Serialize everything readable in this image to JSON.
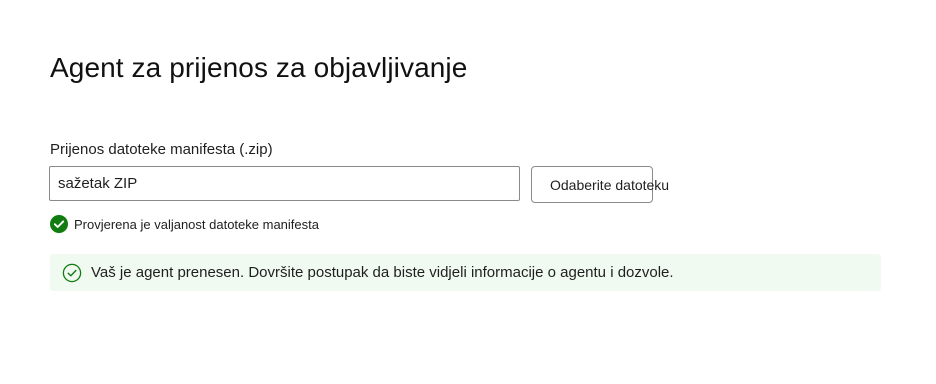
{
  "page": {
    "title": "Agent za prijenos za objavljivanje"
  },
  "upload": {
    "label": "Prijenos datoteke manifesta (.zip)",
    "file_value": "sažetak ZIP",
    "choose_button_label": "Odaberite datoteku"
  },
  "validation": {
    "icon": "checkmark-circle-filled-icon",
    "message": "Provjerena je valjanost datoteke manifesta"
  },
  "success_banner": {
    "icon": "checkmark-circle-outline-icon",
    "message": "Vaš je agent prenesen. Dovršite postupak da biste vidjeli informacije o agentu i dozvole."
  },
  "colors": {
    "success_green": "#107c10",
    "banner_background": "#f1faf1",
    "border": "#8a8a8a",
    "text": "#1f1f1f"
  }
}
